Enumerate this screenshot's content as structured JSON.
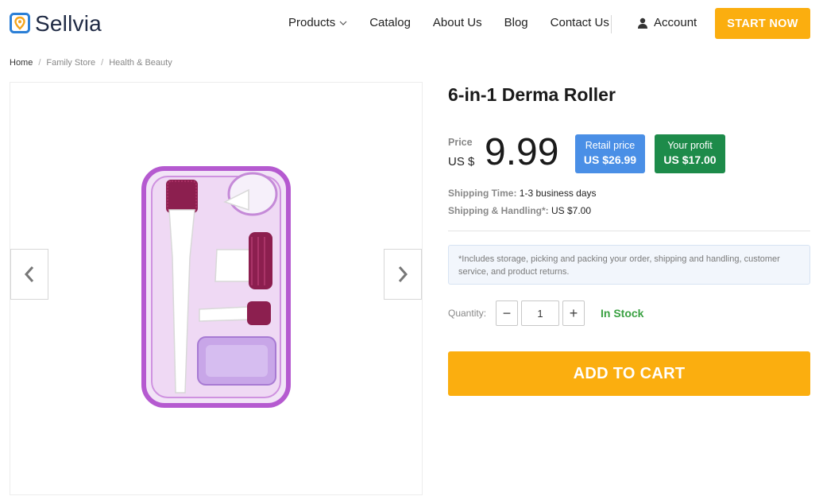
{
  "brand": {
    "name": "Sellvia",
    "accent": "#fbae0f",
    "logo_color": "#2b7fd6"
  },
  "nav": {
    "items": [
      {
        "label": "Products",
        "icon": "chevron-down-icon"
      },
      {
        "label": "Catalog"
      },
      {
        "label": "About Us"
      },
      {
        "label": "Blog"
      },
      {
        "label": "Contact Us"
      }
    ],
    "account_label": "Account",
    "account_icon": "user-icon",
    "cta_label": "START NOW"
  },
  "breadcrumb": {
    "items": [
      "Home",
      "Family Store",
      "Health & Beauty"
    ],
    "separator": "/"
  },
  "gallery": {
    "prev_icon": "chevron-left-icon",
    "next_icon": "chevron-right-icon"
  },
  "product": {
    "title": "6-in-1 Derma Roller",
    "price_label": "Price",
    "currency": "US $",
    "price": "9.99",
    "retail_label": "Retail price",
    "retail_value": "US $26.99",
    "retail_color": "#4a8fe6",
    "profit_label": "Your profit",
    "profit_value": "US $17.00",
    "profit_color": "#1d8b4a",
    "shipping_time_label": "Shipping Time:",
    "shipping_time_value": "1-3 business days",
    "shipping_handling_label": "Shipping & Handling*:",
    "shipping_handling_value": "US $7.00",
    "note": "*Includes storage, picking and packing your order, shipping and handling, customer service, and product returns.",
    "quantity_label": "Quantity:",
    "quantity_value": "1",
    "minus_symbol": "−",
    "plus_symbol": "+",
    "stock_status": "In Stock",
    "stock_color": "#3aa142",
    "add_to_cart_label": "ADD TO CART"
  }
}
